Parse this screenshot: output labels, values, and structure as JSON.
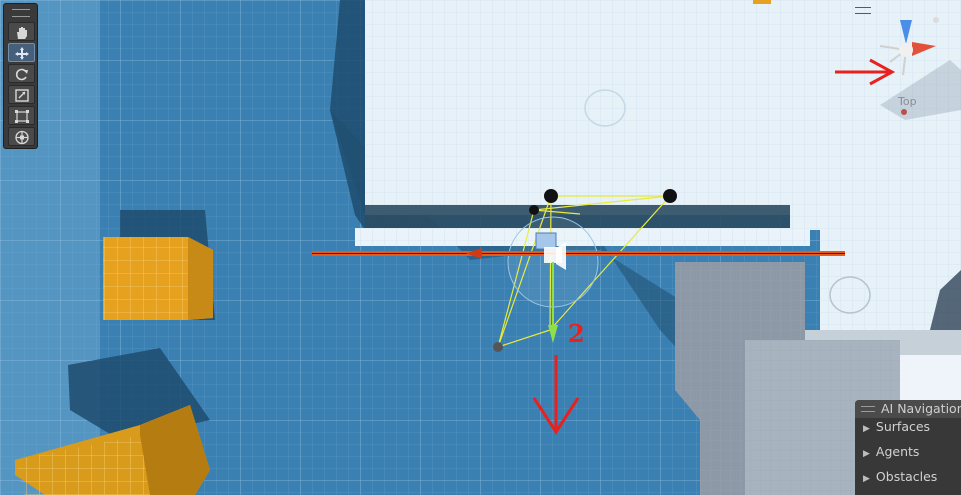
{
  "scene_view": {
    "view_label": "Top",
    "annotation_number": "2"
  },
  "tools": [
    {
      "name": "hand-tool",
      "icon": "hand-icon",
      "active": false
    },
    {
      "name": "move-tool",
      "icon": "move-icon",
      "active": true
    },
    {
      "name": "rotate-tool",
      "icon": "rotate-icon",
      "active": false
    },
    {
      "name": "scale-tool",
      "icon": "scale-icon",
      "active": false
    },
    {
      "name": "rect-tool",
      "icon": "rect-icon",
      "active": false
    },
    {
      "name": "transform-tool",
      "icon": "transform-icon",
      "active": false
    }
  ],
  "ai_navigation": {
    "title": "AI Navigation",
    "items": [
      "Surfaces",
      "Agents",
      "Obstacles"
    ]
  },
  "colors": {
    "annotation_red": "#e8211e",
    "gizmo_yellow": "#e8ea3a",
    "cube_orange": "#e6a11f",
    "axis_green": "#8ee04a"
  }
}
